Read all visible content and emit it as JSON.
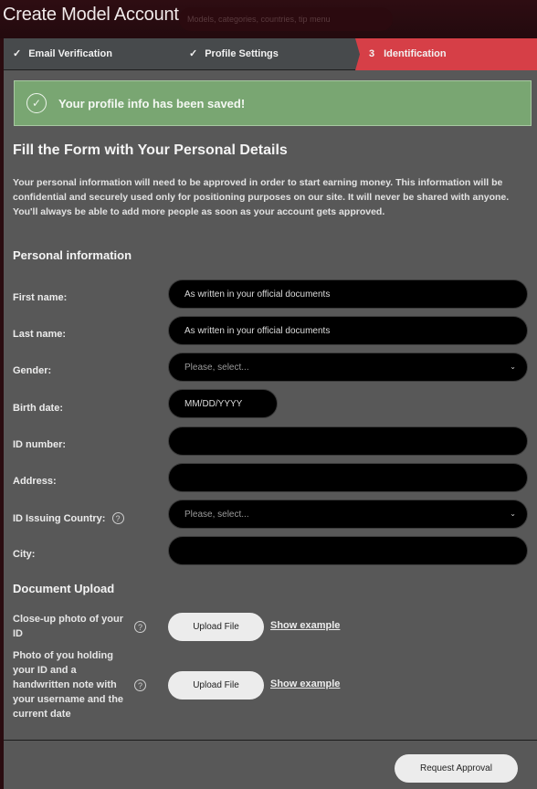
{
  "header": {
    "title": "Create Model Account",
    "search_placeholder": "Models, categories, countries, tip menu"
  },
  "steps": [
    {
      "label": "Email Verification",
      "state": "done",
      "marker": "✓"
    },
    {
      "label": "Profile Settings",
      "state": "done",
      "marker": "✓"
    },
    {
      "label": "Identification",
      "state": "active",
      "marker": "3"
    }
  ],
  "alert": {
    "icon": "check-circle-icon",
    "text": "Your profile info has been saved!"
  },
  "form": {
    "title": "Fill the Form with Your Personal Details",
    "intro_1": "Your personal information will need to be approved in order to start earning money. This information will be confidential and securely used only for positioning purposes on our site. It will never be shared with anyone.",
    "intro_2": "You'll always be able to add more people as soon as your account gets approved.",
    "personal_title": "Personal information",
    "fields": {
      "first_name": {
        "label": "First name:",
        "placeholder": "As written in your official documents"
      },
      "last_name": {
        "label": "Last name:",
        "placeholder": "As written in your official documents"
      },
      "gender": {
        "label": "Gender:",
        "value": "Please, select..."
      },
      "birth_date": {
        "label": "Birth date:",
        "placeholder": "MM/DD/YYYY"
      },
      "id_number": {
        "label": "ID number:",
        "placeholder": ""
      },
      "address": {
        "label": "Address:",
        "placeholder": ""
      },
      "country": {
        "label": "ID Issuing Country:",
        "value": "Please, select..."
      },
      "city": {
        "label": "City:",
        "placeholder": ""
      }
    },
    "help_glyph": "?",
    "chevron_glyph": "⌄"
  },
  "upload": {
    "title": "Document Upload",
    "items": [
      {
        "label": "Close-up photo of your ID",
        "button": "Upload File",
        "link": "Show example"
      },
      {
        "label": "Photo of you holding your ID and a handwritten note with your username and the current date",
        "button": "Upload File",
        "link": "Show example"
      }
    ]
  },
  "footer": {
    "submit_label": "Request Approval"
  }
}
